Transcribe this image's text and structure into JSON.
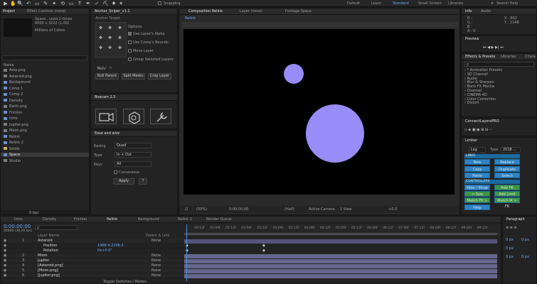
{
  "toolbar": {
    "tools": [
      "▶",
      "✋",
      "🔍",
      "↶",
      "▭",
      "✎",
      "✦",
      "⟲",
      "▭",
      "T",
      "✒",
      "✓",
      "⛏",
      "♦",
      "✶"
    ],
    "snapping_label": "Snapping",
    "workspaces": [
      "Default",
      "Learn",
      "Standard",
      "Small Screen",
      "Libraries"
    ],
    "active_workspace": "Standard",
    "search_placeholder": "Search Help"
  },
  "project": {
    "tab": "Project",
    "tab2": "Effect Controls (none)",
    "info_line1": "Space , used 2 times",
    "info_line2": "6000 x 3222 (1.00)",
    "info_line3": "Millions of Colors",
    "column_name": "Name",
    "items": [
      {
        "name": "Amp.png",
        "type": "file"
      },
      {
        "name": "Asteroid.png",
        "type": "file"
      },
      {
        "name": "Background",
        "type": "comp"
      },
      {
        "name": "Comp 1",
        "type": "comp"
      },
      {
        "name": "Comp 2",
        "type": "comp"
      },
      {
        "name": "Density",
        "type": "comp"
      },
      {
        "name": "Earth.png",
        "type": "file"
      },
      {
        "name": "Friction",
        "type": "comp"
      },
      {
        "name": "Intro",
        "type": "comp"
      },
      {
        "name": "Jupiter.png",
        "type": "file"
      },
      {
        "name": "Moon.png",
        "type": "file"
      },
      {
        "name": "Relink",
        "type": "comp"
      },
      {
        "name": "Relink 2",
        "type": "comp"
      },
      {
        "name": "Solids",
        "type": "folder"
      },
      {
        "name": "Space",
        "type": "comp",
        "selected": true
      },
      {
        "name": "Studio",
        "type": "file"
      }
    ],
    "footer_bpc": "8 bpc"
  },
  "anchor": {
    "tab": "Anchor_Sniper_v1.1",
    "anchor_label": "Anchor Target",
    "options_label": "Options",
    "options": [
      {
        "label": "Use Layer's Alpha",
        "checked": true
      },
      {
        "label": "Use Comp's Bounds",
        "checked": false
      },
      {
        "label": "Move Layer",
        "checked": false
      },
      {
        "label": "Group Selected Layers",
        "checked": false
      }
    ],
    "tools_label": "Tools",
    "tool_buttons": [
      "Null Parent",
      "Split Masks",
      "Crop Layer"
    ]
  },
  "boxcam": {
    "tab": "Boxcam 2.5"
  },
  "ease": {
    "tab": "Ease and wizz",
    "easing_label": "Easing",
    "easing_value": "Quad",
    "type_label": "Type",
    "type_value": "In + Out",
    "keys_label": "Keys",
    "keys_value": "All",
    "curviness_label": "Curvaceous",
    "apply_label": "Apply",
    "help_label": "?"
  },
  "composition": {
    "tab": "Composition Relink",
    "tab_layer": "Layer (none)",
    "tab_footage": "Footage Space",
    "breadcrumb": "Relink",
    "zoom": "(50%)",
    "timecode": "0:00:00:00",
    "resolution": "(Half)",
    "camera": "Active Camera",
    "view": "1 View",
    "exposure": "+0.0"
  },
  "info_panel": {
    "tab": "Info",
    "tab2": "Audio",
    "rgb": [
      "R :",
      "G :",
      "B :",
      "A : 0"
    ],
    "coords": [
      "X : 602",
      "Y : 1148"
    ]
  },
  "preview": {
    "tab": "Preview"
  },
  "effects": {
    "tab": "Effects & Presets",
    "tab2": "Libraries",
    "tab3": "Chara",
    "search_placeholder": "ρ",
    "items": [
      "* Animation Presets",
      "3D Channel",
      "Audio",
      "Blur & Sharpen",
      "Boris FX Mocha",
      "Channel",
      "CINEMA 4D",
      "Color Correction",
      "Distort"
    ]
  },
  "connect_layers": {
    "tab": "ConnectLayersPRO"
  },
  "limber": {
    "tab": "Limber",
    "leg_value": "Leg",
    "type_label": "Type",
    "type_value": "2018 ...",
    "links_title": "LINKS",
    "links_buttons": [
      "New",
      "Replace",
      "Copy",
      "Duplicate",
      "Paste",
      "Select"
    ],
    "controllers_title": "CONTROLLERS",
    "controller_buttons": [
      {
        "label": "Hide / Show",
        "color": "blue"
      },
      {
        "label": "Add FK",
        "color": "green"
      },
      {
        "label": "↔ Size",
        "color": "green"
      },
      {
        "label": "Add Limit",
        "color": "green"
      },
      {
        "label": "Match FK > IK",
        "color": "green"
      },
      {
        "label": "Match IK > FK",
        "color": "green"
      }
    ],
    "help_label": "Help"
  },
  "timeline": {
    "tabs": [
      "Intro",
      "Density",
      "Friction",
      "Relink",
      "Background"
    ],
    "active_tab": "Relink",
    "timecode": "0:00:00:00",
    "frame_info": "00000 (30.00 fps)",
    "search_placeholder": "ρ",
    "col_layer_name": "Layer Name",
    "col_parent": "Parent & Link",
    "footer": "Toggle Switches / Modes",
    "ruler_ticks": [
      "00:12f",
      "01:00f",
      "01:12f",
      "02:00f",
      "02:12f",
      "03:00f",
      "03:12f",
      "04:00f",
      "04:12f",
      "05:00f",
      "05:12f",
      "06:00f",
      "06:12f",
      "07:00f",
      "07:12f",
      "08:00f",
      "08:12f",
      "09:00f",
      "09:12f"
    ],
    "layers": [
      {
        "num": "1",
        "name": "Asteroid",
        "parent": "None",
        "indent": 0,
        "kind": "layer"
      },
      {
        "num": "",
        "name": "Position",
        "value": "1968.4,2206.3",
        "indent": 1,
        "kind": "prop"
      },
      {
        "num": "",
        "name": "Rotation",
        "value": "0x+0.0°",
        "indent": 1,
        "kind": "prop"
      },
      {
        "num": "2",
        "name": "Moon",
        "parent": "None",
        "indent": 0,
        "kind": "layer"
      },
      {
        "num": "3",
        "name": "Jupiter",
        "parent": "None",
        "indent": 0,
        "kind": "layer"
      },
      {
        "num": "4",
        "name": "[Asteroid.png]",
        "parent": "None",
        "indent": 0,
        "kind": "layer"
      },
      {
        "num": "5",
        "name": "[Moon.png]",
        "parent": "None",
        "indent": 0,
        "kind": "layer"
      },
      {
        "num": "6",
        "name": "[Jupiter.png]",
        "parent": "None",
        "indent": 0,
        "kind": "layer"
      }
    ]
  },
  "render": {
    "tab": "Relink 2",
    "tab2": "Render Queue"
  },
  "paragraph": {
    "tab": "Paragraph",
    "fields": [
      "0 px",
      "0 px",
      "0 px",
      "0 px",
      "0 px"
    ]
  }
}
